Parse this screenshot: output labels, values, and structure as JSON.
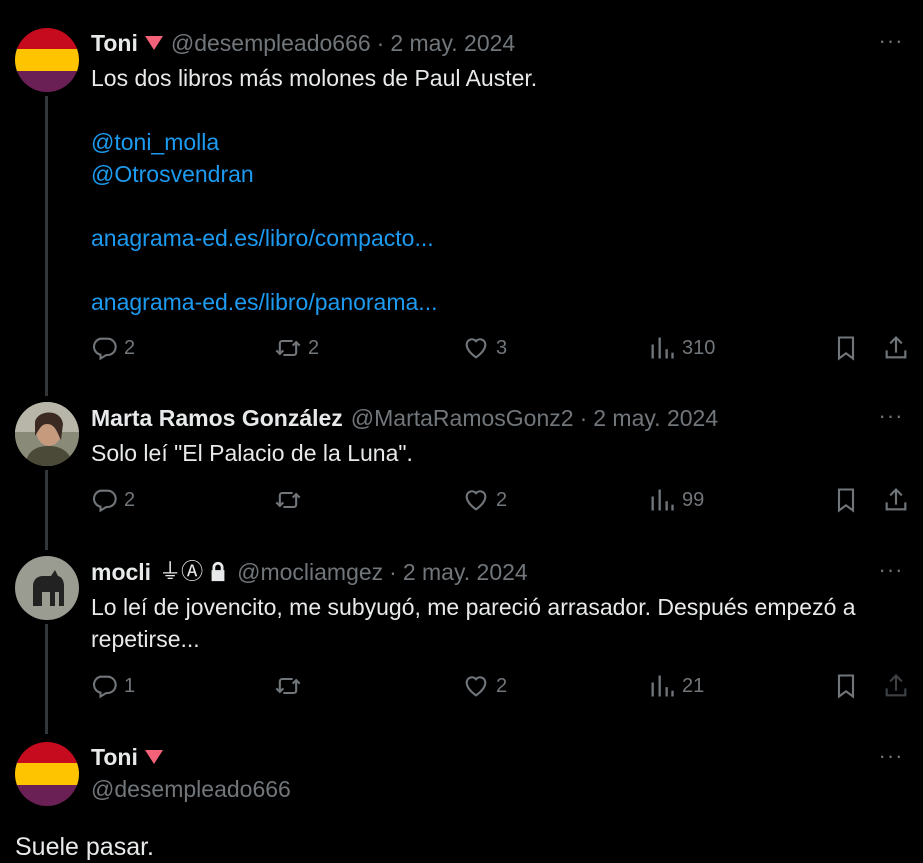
{
  "tweets": [
    {
      "name": "Toni",
      "handle": "@desempleado666",
      "dot": "·",
      "date": "2 may. 2024",
      "text": "Los dos libros más molones de Paul Auster.",
      "mentions": [
        "@toni_molla",
        "@Otrosvendran"
      ],
      "links": [
        "anagrama-ed.es/libro/compacto...",
        "anagrama-ed.es/libro/panorama..."
      ],
      "replies": "2",
      "reposts": "2",
      "likes": "3",
      "views": "310"
    },
    {
      "name": "Marta Ramos González",
      "handle": "@MartaRamosGonz2",
      "dot": "·",
      "date": "2 may. 2024",
      "text": "Solo leí \"El Palacio de la Luna\".",
      "replies": "2",
      "reposts": "",
      "likes": "2",
      "views": "99"
    },
    {
      "name": "mocli",
      "name_badges": "⏚Ⓐ",
      "handle": "@mocliamgez",
      "dot": "·",
      "date": "2 may. 2024",
      "text": "Lo leí de jovencito, me subyugó, me pareció arrasador. Después empezó a repetirse...",
      "replies": "1",
      "reposts": "",
      "likes": "2",
      "views": "21"
    },
    {
      "name": "Toni",
      "handle": "@desempleado666",
      "text": "Suele pasar."
    }
  ],
  "more_label": "···",
  "colors": {
    "accent": "#1d9bf0",
    "muted": "#71767b",
    "background": "#000000",
    "text": "#e7e9ea",
    "badge": "#f4627a"
  }
}
